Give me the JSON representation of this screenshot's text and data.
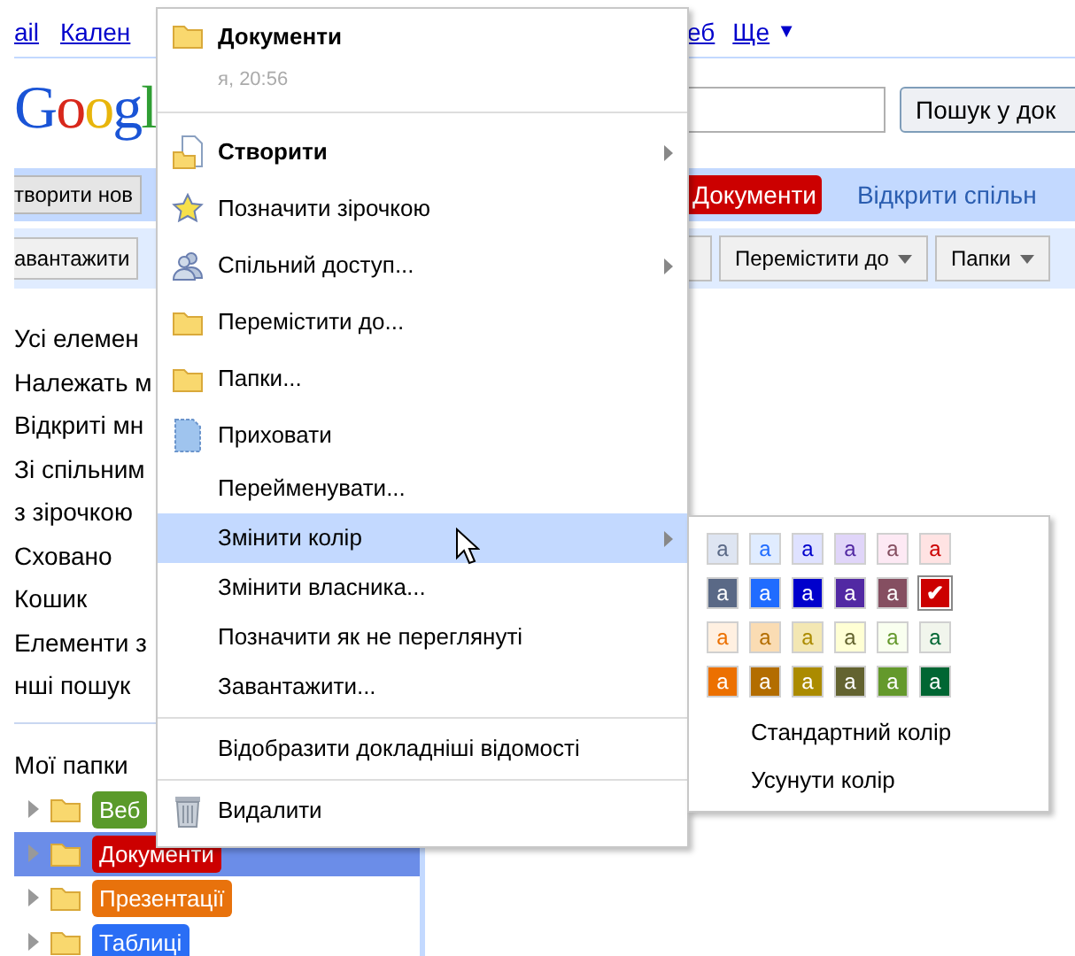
{
  "top_links": {
    "left": [
      "ail",
      "Кален"
    ],
    "right": [
      "еб",
      "Ще"
    ],
    "more_arrow": "▼"
  },
  "logo": "Googl",
  "search": {
    "button": "Пошук у док"
  },
  "action_bar": {
    "create_button": "творити нов",
    "current_folder_badge": "Документи",
    "link": "Відкрити спільн"
  },
  "toolbar": {
    "upload_button": "авантажити",
    "move_button": "Перемістити до",
    "folders_button": "Папки"
  },
  "sidebar": {
    "items": [
      "Усі елемен",
      "Належать м",
      "Відкриті мн",
      "Зі спільним",
      "з зірочкою",
      "Сховано",
      "Кошик",
      "Елементи з",
      "нші пошук"
    ],
    "my_folders_title": "Мої папки",
    "folders": [
      {
        "label": "Веб",
        "color": "#5a9a2a",
        "selected": false
      },
      {
        "label": "Документи",
        "color": "#cc0000",
        "selected": true
      },
      {
        "label": "Презентації",
        "color": "#e8720c",
        "selected": false
      },
      {
        "label": "Таблиці",
        "color": "#2a6ef5",
        "selected": false
      }
    ]
  },
  "context_menu": {
    "title": "Документи",
    "subtitle": "я, 20:56",
    "groups": [
      [
        {
          "label": "Створити",
          "kind": "bold",
          "submenu": true,
          "selected": false
        },
        {
          "label": "Позначити зірочкою",
          "kind": "plain",
          "submenu": false,
          "selected": false
        },
        {
          "label": "Спільний доступ...",
          "kind": "plain",
          "submenu": true,
          "selected": false
        },
        {
          "label": "Перемістити до...",
          "kind": "plain",
          "submenu": false,
          "selected": false
        },
        {
          "label": "Папки...",
          "kind": "plain",
          "submenu": false,
          "selected": false
        },
        {
          "label": "Приховати",
          "kind": "plain",
          "submenu": false,
          "selected": false
        },
        {
          "label": "Перейменувати...",
          "kind": "plain",
          "submenu": false,
          "selected": false
        },
        {
          "label": "Змінити колір",
          "kind": "plain",
          "submenu": true,
          "selected": true
        },
        {
          "label": "Змінити власника...",
          "kind": "plain",
          "submenu": false,
          "selected": false
        },
        {
          "label": "Позначити як не переглянуті",
          "kind": "plain",
          "submenu": false,
          "selected": false
        },
        {
          "label": "Завантажити...",
          "kind": "plain",
          "submenu": false,
          "selected": false
        }
      ],
      [
        {
          "label": "Відобразити докладніші відомості",
          "kind": "plain",
          "submenu": false,
          "selected": false
        }
      ],
      [
        {
          "label": "Видалити",
          "kind": "plain",
          "submenu": false,
          "selected": false
        }
      ]
    ]
  },
  "color_menu": {
    "rows": [
      {
        "kind": "light",
        "swatches": [
          {
            "label": "a",
            "color": "#dee5f2",
            "selected": false
          },
          {
            "label": "a",
            "color": "#e0ecff",
            "selected": false
          },
          {
            "label": "a",
            "color": "#dfe2ff",
            "selected": false
          },
          {
            "label": "a",
            "color": "#e0d5f9",
            "selected": false
          },
          {
            "label": "a",
            "color": "#fde9f4",
            "selected": false
          },
          {
            "label": "a",
            "color": "#ffe3e3",
            "selected": false
          }
        ]
      },
      {
        "kind": "dark",
        "swatches": [
          {
            "label": "a",
            "color": "#5a6986",
            "selected": false
          },
          {
            "label": "a",
            "color": "#206cff",
            "selected": false
          },
          {
            "label": "a",
            "color": "#0000cc",
            "selected": false
          },
          {
            "label": "a",
            "color": "#5229a3",
            "selected": false
          },
          {
            "label": "a",
            "color": "#854f61",
            "selected": false
          },
          {
            "label": "✔",
            "color": "#cc0000",
            "selected": true
          }
        ]
      },
      {
        "kind": "light",
        "swatches": [
          {
            "label": "a",
            "color": "#fff0e1",
            "selected": false
          },
          {
            "label": "a",
            "color": "#fadcb3",
            "selected": false
          },
          {
            "label": "a",
            "color": "#f3e7b3",
            "selected": false
          },
          {
            "label": "a",
            "color": "#ffffd4",
            "selected": false
          },
          {
            "label": "a",
            "color": "#f9ffef",
            "selected": false
          },
          {
            "label": "a",
            "color": "#f1f5ec",
            "selected": false
          }
        ]
      },
      {
        "kind": "dark",
        "swatches": [
          {
            "label": "a",
            "color": "#ec7000",
            "selected": false
          },
          {
            "label": "a",
            "color": "#b36d00",
            "selected": false
          },
          {
            "label": "a",
            "color": "#ab8b00",
            "selected": false
          },
          {
            "label": "a",
            "color": "#636330",
            "selected": false
          },
          {
            "label": "a",
            "color": "#64992c",
            "selected": false
          },
          {
            "label": "a",
            "color": "#006633",
            "selected": false
          }
        ]
      }
    ],
    "options": [
      "Стандартний колір",
      "Усунути колір"
    ]
  }
}
